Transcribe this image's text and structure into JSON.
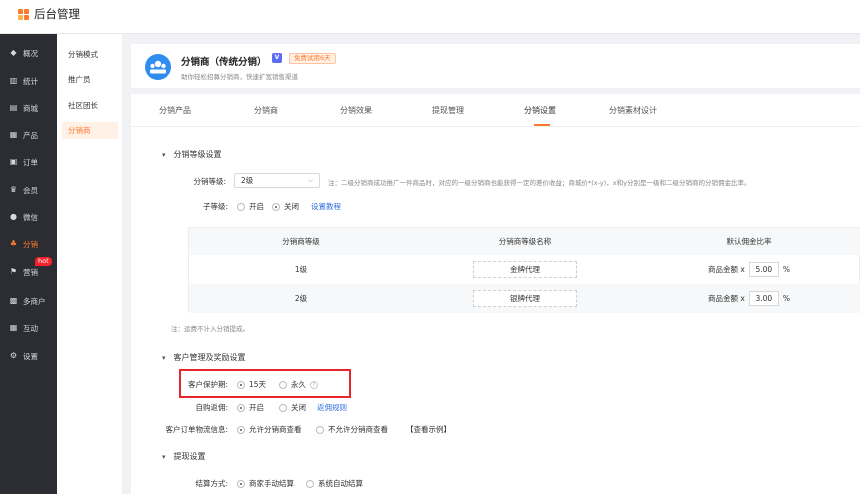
{
  "app": {
    "title": "后台管理"
  },
  "sidebar": {
    "items": [
      {
        "label": "概况",
        "icon": "dashboard-icon"
      },
      {
        "label": "统计",
        "icon": "chart-icon"
      },
      {
        "label": "商城",
        "icon": "store-icon"
      },
      {
        "label": "产品",
        "icon": "grid-icon"
      },
      {
        "label": "订单",
        "icon": "order-icon"
      },
      {
        "label": "会员",
        "icon": "crown-icon"
      },
      {
        "label": "微信",
        "icon": "wechat-icon"
      },
      {
        "label": "分销",
        "icon": "users-icon",
        "active": true
      },
      {
        "label": "营销",
        "icon": "flag-icon",
        "badge": "hot"
      },
      {
        "label": "多商户",
        "icon": "shop-icon"
      },
      {
        "label": "互动",
        "icon": "interact-icon"
      },
      {
        "label": "设置",
        "icon": "gear-icon"
      }
    ]
  },
  "subnav": {
    "items": [
      "分销模式",
      "推广员",
      "社区团长",
      "分销商"
    ],
    "active": "分销商"
  },
  "header": {
    "title": "分销商（传统分销）",
    "version_badge": "V",
    "trial": "免费试用6天",
    "desc": "助你轻松招募分销商，快速扩宽销售渠道"
  },
  "tabs": [
    "分销产品",
    "分销商",
    "分销效果",
    "提现管理",
    "分销设置",
    "分销素材设计"
  ],
  "active_tab": "分销设置",
  "level_section": {
    "title": "分销等级设置",
    "level_label": "分销等级:",
    "level_value": "2级",
    "level_note": "注：二级分销商成功推广一件商品时，对应的一级分销商也能获得一定的差价收益；商城价*(x-y)，x和y分别是一级和二级分销商的分销佣金比率。",
    "sublevel_label": "子等级:",
    "sublevel_on": "开启",
    "sublevel_off": "关闭",
    "sublevel_link": "设置教程",
    "table_headers": [
      "分销商等级",
      "分销商等级名称",
      "默认佣金比率"
    ],
    "rows": [
      {
        "level": "1级",
        "name": "金牌代理",
        "prefix": "商品金额 x",
        "rate": "5.00",
        "unit": "%"
      },
      {
        "level": "2级",
        "name": "银牌代理",
        "prefix": "商品金额 x",
        "rate": "3.00",
        "unit": "%"
      }
    ],
    "footnote": "注：运费不计入分销提成。"
  },
  "customer_section": {
    "title": "客户管理及奖励设置",
    "protect_label": "客户保护期:",
    "protect_opt1": "15天",
    "protect_opt2": "永久",
    "protect_help": "?",
    "selfbuy_label": "自购返佣:",
    "selfbuy_on": "开启",
    "selfbuy_off": "关闭",
    "selfbuy_link": "返佣规则",
    "logistics_label": "客户订单物流信息:",
    "logistics_opt1": "允许分销商查看",
    "logistics_opt2": "不允许分销商查看",
    "logistics_example": "【查看示例】"
  },
  "withdraw_section": {
    "title": "提现设置",
    "method_label": "结算方式:",
    "method_opt1": "商家手动结算",
    "method_opt2": "系统自动结算"
  },
  "colors": {
    "accent": "#ff7a2e",
    "link": "#2f6fe0",
    "sidebar": "#2b2d33",
    "highlight": "#e8262b"
  }
}
